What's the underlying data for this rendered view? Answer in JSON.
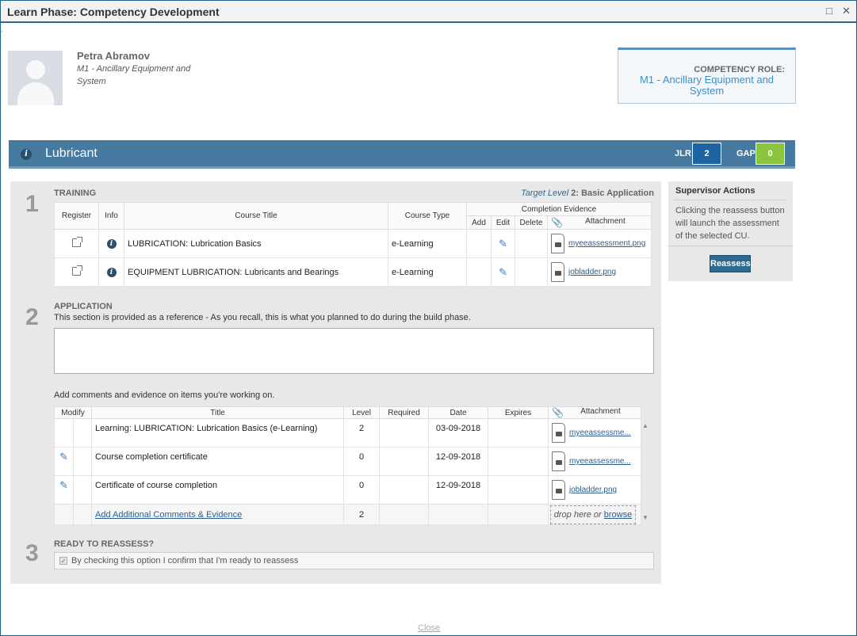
{
  "window": {
    "title": "Learn Phase: Competency Development",
    "maximize_icon": "□",
    "close_icon": "✕"
  },
  "user": {
    "name": "Petra Abramov",
    "role": "M1 - Ancillary Equipment and System"
  },
  "competency_role": {
    "label": "COMPETENCY ROLE:",
    "value": "M1 - Ancillary Equipment and System"
  },
  "cu": {
    "title": "Lubricant",
    "jlr_label": "JLR",
    "jlr_value": "2",
    "gap_label": "GAP",
    "gap_value": "0",
    "colors": {
      "bar": "#467aa0",
      "jlr": "#1f64a2",
      "gap": "#8cc63f"
    }
  },
  "training": {
    "step": "1",
    "heading": "TRAINING",
    "target_level_label": "Target Level",
    "target_level_value": "2: Basic Application",
    "headers": {
      "register": "Register",
      "info": "Info",
      "course_title": "Course Title",
      "course_type": "Course Type",
      "completion_evidence": "Completion Evidence",
      "add": "Add",
      "edit": "Edit",
      "delete": "Delete",
      "attachment": "Attachment"
    },
    "rows": [
      {
        "title": "LUBRICATION: Lubrication Basics",
        "type": "e-Learning",
        "attachment": "myeeassessment.png"
      },
      {
        "title": "EQUIPMENT LUBRICATION: Lubricants and Bearings",
        "type": "e-Learning",
        "attachment": "jobladder.png"
      }
    ]
  },
  "application": {
    "step": "2",
    "heading": "APPLICATION",
    "description": "This section is provided as a reference - As you recall, this is what you planned to do during the build phase.",
    "plan_text": "",
    "comments_note": "Add comments and evidence on items you're working on.",
    "headers": {
      "modify": "Modify",
      "title": "Title",
      "level": "Level",
      "required": "Required",
      "date": "Date",
      "expires": "Expires",
      "attachment": "Attachment"
    },
    "rows": [
      {
        "title": "Learning: LUBRICATION: Lubrication Basics (e-Learning)",
        "level": "2",
        "required": "",
        "date": "03-09-2018",
        "expires": "",
        "attachment": "myeeassessme..."
      },
      {
        "title": "Course completion certificate",
        "level": "0",
        "required": "",
        "date": "12-09-2018",
        "expires": "",
        "attachment": "myeeassessme..."
      },
      {
        "title": "Certificate of course completion",
        "level": "0",
        "required": "",
        "date": "12-09-2018",
        "expires": "",
        "attachment": "jobladder.png"
      }
    ],
    "add_link": "Add Additional Comments & Evidence",
    "add_level": "2",
    "drop_text": "drop here or",
    "browse": "browse"
  },
  "ready": {
    "step": "3",
    "heading": "READY TO REASSESS?",
    "checkbox_label": "By checking this option I confirm that I'm ready to reassess",
    "checked": true
  },
  "supervisor": {
    "title": "Supervisor Actions",
    "text": "Clicking the reassess button will launch the assessment of the selected CU.",
    "button": "Reassess"
  },
  "footer": {
    "close": "Close"
  }
}
